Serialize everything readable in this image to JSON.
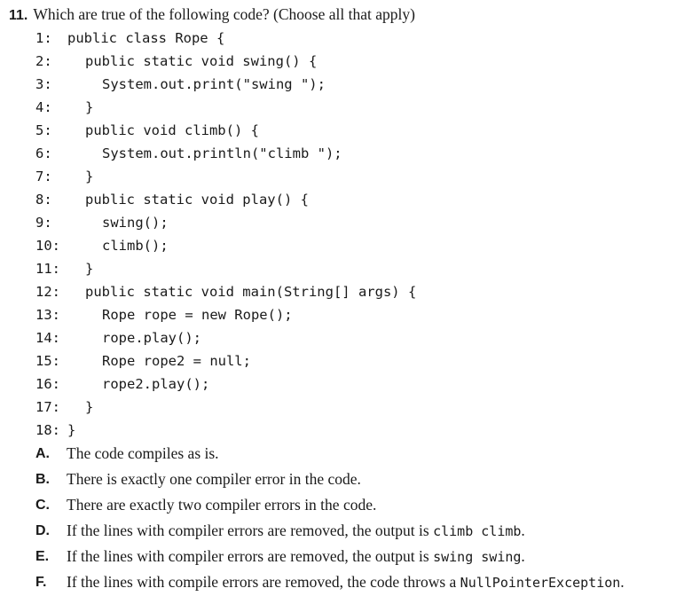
{
  "question": {
    "number": "11.",
    "text": "Which are true of the following code? (Choose all that apply)"
  },
  "code": [
    {
      "n": "1:",
      "text": "public class Rope {"
    },
    {
      "n": "2:",
      "text": "public static void swing() {"
    },
    {
      "n": "3:",
      "text": "System.out.print(\"swing \");"
    },
    {
      "n": "4:",
      "text": "}"
    },
    {
      "n": "5:",
      "text": "public void climb() {"
    },
    {
      "n": "6:",
      "text": "System.out.println(\"climb \");"
    },
    {
      "n": "7:",
      "text": "}"
    },
    {
      "n": "8:",
      "text": "public static void play() {"
    },
    {
      "n": "9:",
      "text": "swing();"
    },
    {
      "n": "10:",
      "text": "climb();"
    },
    {
      "n": "11:",
      "text": "}"
    },
    {
      "n": "12:",
      "text": "public static void main(String[] args) {"
    },
    {
      "n": "13:",
      "text": "Rope rope = new Rope();"
    },
    {
      "n": "14:",
      "text": "rope.play();"
    },
    {
      "n": "15:",
      "text": "Rope rope2 = null;"
    },
    {
      "n": "16:",
      "text": "rope2.play();"
    },
    {
      "n": "17:",
      "text": "}"
    },
    {
      "n": "18:",
      "text": "}"
    }
  ],
  "options": [
    {
      "letter": "A.",
      "text": "The code compiles as is."
    },
    {
      "letter": "B.",
      "text": "There is exactly one compiler error in the code."
    },
    {
      "letter": "C.",
      "text": "There are exactly two compiler errors in the code."
    },
    {
      "letter": "D.",
      "text": "If the lines with compiler errors are removed, the output is",
      "code": "climb climb",
      "suffix": "."
    },
    {
      "letter": "E.",
      "text": "If the lines with compiler errors are removed, the output is",
      "code": "swing swing",
      "suffix": "."
    },
    {
      "letter": "F.",
      "text": "If the lines with compile errors are removed, the code throws a",
      "code": "NullPointerException",
      "suffix": "."
    }
  ]
}
